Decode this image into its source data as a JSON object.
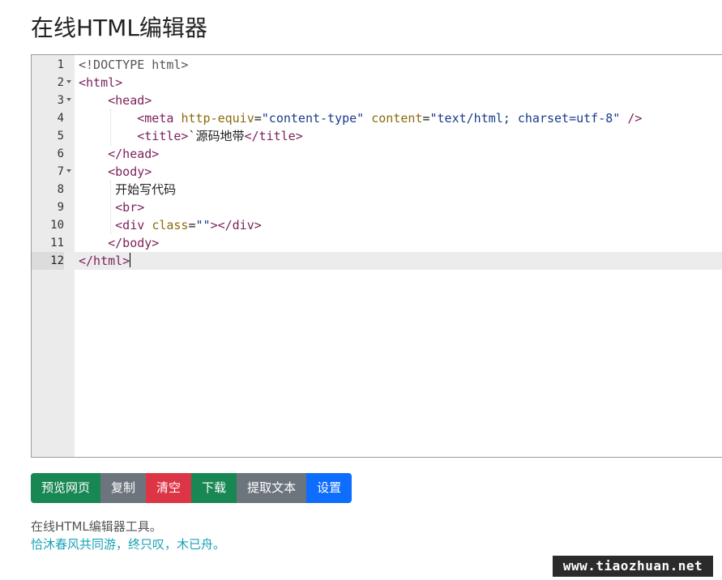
{
  "page": {
    "title": "在线HTML编辑器"
  },
  "editor": {
    "lines": [
      {
        "num": "1",
        "fold": false,
        "tokens": [
          {
            "c": "t-doc",
            "t": "<!DOCTYPE html>"
          }
        ]
      },
      {
        "num": "2",
        "fold": true,
        "tokens": [
          {
            "c": "t-tag",
            "t": "<html>"
          }
        ]
      },
      {
        "num": "3",
        "fold": true,
        "tokens": [
          {
            "c": "t-txt",
            "t": "    "
          },
          {
            "c": "t-tag",
            "t": "<head>"
          }
        ]
      },
      {
        "num": "4",
        "fold": false,
        "tokens": [
          {
            "c": "t-txt",
            "t": "        "
          },
          {
            "c": "t-tag",
            "t": "<meta "
          },
          {
            "c": "t-attr",
            "t": "http-equiv"
          },
          {
            "c": "t-txt",
            "t": "="
          },
          {
            "c": "t-str",
            "t": "\"content-type\""
          },
          {
            "c": "t-txt",
            "t": " "
          },
          {
            "c": "t-attr",
            "t": "content"
          },
          {
            "c": "t-txt",
            "t": "="
          },
          {
            "c": "t-str",
            "t": "\"text/html; charset=utf-8\""
          },
          {
            "c": "t-txt",
            "t": " "
          },
          {
            "c": "t-tag",
            "t": "/>"
          }
        ]
      },
      {
        "num": "5",
        "fold": false,
        "tokens": [
          {
            "c": "t-txt",
            "t": "        "
          },
          {
            "c": "t-tag",
            "t": "<title>"
          },
          {
            "c": "t-txt",
            "t": "`源码地带"
          },
          {
            "c": "t-tag",
            "t": "</title>"
          }
        ]
      },
      {
        "num": "6",
        "fold": false,
        "tokens": [
          {
            "c": "t-txt",
            "t": "    "
          },
          {
            "c": "t-tag",
            "t": "</head>"
          }
        ]
      },
      {
        "num": "7",
        "fold": true,
        "tokens": [
          {
            "c": "t-txt",
            "t": "    "
          },
          {
            "c": "t-tag",
            "t": "<body>"
          }
        ]
      },
      {
        "num": "8",
        "fold": false,
        "tokens": [
          {
            "c": "t-txt",
            "t": "     开始写代码"
          }
        ]
      },
      {
        "num": "9",
        "fold": false,
        "tokens": [
          {
            "c": "t-txt",
            "t": "     "
          },
          {
            "c": "t-tag",
            "t": "<br>"
          }
        ]
      },
      {
        "num": "10",
        "fold": false,
        "tokens": [
          {
            "c": "t-txt",
            "t": "     "
          },
          {
            "c": "t-tag",
            "t": "<div "
          },
          {
            "c": "t-attr",
            "t": "class"
          },
          {
            "c": "t-txt",
            "t": "="
          },
          {
            "c": "t-str",
            "t": "\"\""
          },
          {
            "c": "t-tag",
            "t": "></div>"
          }
        ]
      },
      {
        "num": "11",
        "fold": false,
        "tokens": [
          {
            "c": "t-txt",
            "t": "    "
          },
          {
            "c": "t-tag",
            "t": "</body>"
          }
        ]
      },
      {
        "num": "12",
        "fold": false,
        "active": true,
        "tokens": [
          {
            "c": "t-tag",
            "t": "</html>"
          }
        ]
      }
    ]
  },
  "toolbar": {
    "preview_label": "预览网页",
    "copy_label": "复制",
    "clear_label": "清空",
    "download_label": "下载",
    "extract_label": "提取文本",
    "settings_label": "设置"
  },
  "footer": {
    "description": "在线HTML编辑器工具。",
    "quote": "恰沐春风共同游，终只叹，木已舟。",
    "watermark": "www.tiaozhuan.net"
  }
}
